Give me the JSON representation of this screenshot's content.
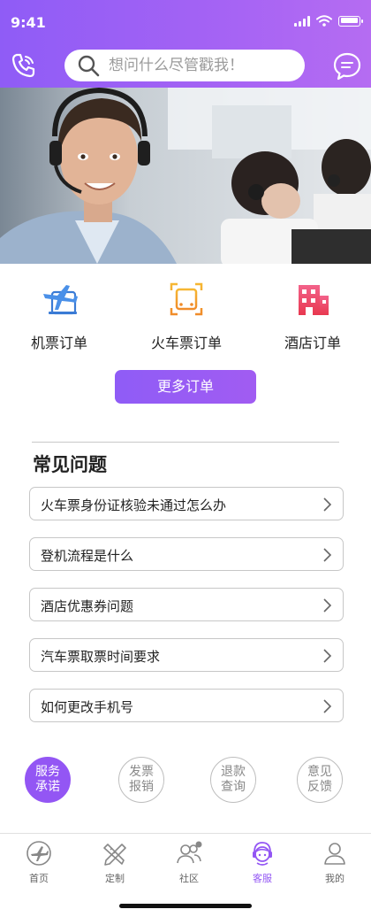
{
  "status_bar": {
    "time": "9:41"
  },
  "header": {
    "search_placeholder": "想问什么尽管戳我！",
    "phone_icon": "phone-icon",
    "message_icon": "chat-bubble-icon"
  },
  "hero": {
    "image": "customer-service-agents-photo"
  },
  "orders": [
    {
      "label": "机票订单",
      "icon": "plane-ticket-icon"
    },
    {
      "label": "火车票订单",
      "icon": "train-ticket-icon"
    },
    {
      "label": "酒店订单",
      "icon": "hotel-icon"
    }
  ],
  "more_orders_label": "更多订单",
  "faq": {
    "title": "常见问题",
    "items": [
      "火车票身份证核验未通过怎么办",
      "登机流程是什么",
      "酒店优惠券问题",
      "汽车票取票时间要求",
      "如何更改手机号"
    ]
  },
  "services": [
    {
      "line1": "服务",
      "line2": "承诺",
      "active": true
    },
    {
      "line1": "发票",
      "line2": "报销",
      "active": false
    },
    {
      "line1": "退款",
      "line2": "查询",
      "active": false
    },
    {
      "line1": "意见",
      "line2": "反馈",
      "active": false
    }
  ],
  "tabbar": [
    {
      "label": "首页",
      "icon": "plane-circle-icon"
    },
    {
      "label": "定制",
      "icon": "pencil-ruler-icon"
    },
    {
      "label": "社区",
      "icon": "community-icon"
    },
    {
      "label": "客服",
      "icon": "headset-agent-icon",
      "active": true
    },
    {
      "label": "我的",
      "icon": "user-icon"
    }
  ],
  "colors": {
    "accent": "#9356f4",
    "header_start": "#8f5cf6",
    "header_end": "#b56cf2"
  }
}
